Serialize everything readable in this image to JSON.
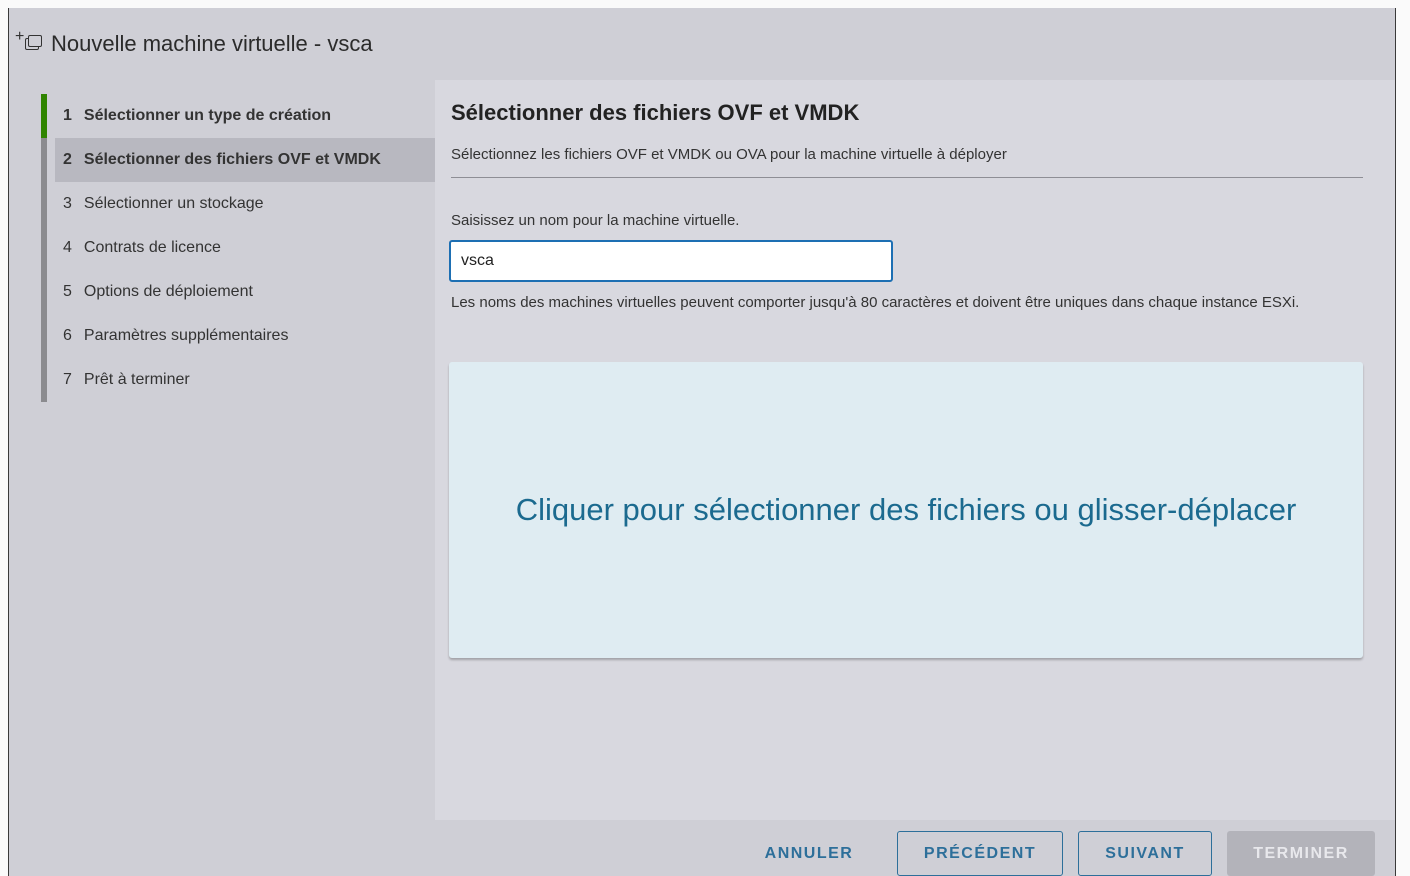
{
  "window": {
    "title": "Nouvelle machine virtuelle - vsca",
    "icon": "new-vm-icon"
  },
  "steps": [
    {
      "num": "1",
      "label": "Sélectionner un type de création",
      "state": "done"
    },
    {
      "num": "2",
      "label": "Sélectionner des fichiers OVF et VMDK",
      "state": "active"
    },
    {
      "num": "3",
      "label": "Sélectionner un stockage",
      "state": "pending"
    },
    {
      "num": "4",
      "label": "Contrats de licence",
      "state": "pending"
    },
    {
      "num": "5",
      "label": "Options de déploiement",
      "state": "pending"
    },
    {
      "num": "6",
      "label": "Paramètres supplémentaires",
      "state": "pending"
    },
    {
      "num": "7",
      "label": "Prêt à terminer",
      "state": "pending"
    }
  ],
  "main": {
    "title": "Sélectionner des fichiers OVF et VMDK",
    "subtitle": "Sélectionnez les fichiers OVF et VMDK ou OVA pour la machine virtuelle à déployer",
    "name_label": "Saisissez un nom pour la machine virtuelle.",
    "name_value": "vsca",
    "help_text": "Les noms des machines virtuelles peuvent comporter jusqu'à 80 caractères et doivent être uniques dans chaque instance ESXi.",
    "dropzone_text": "Cliquer pour sélectionner des fichiers ou glisser-déplacer"
  },
  "footer": {
    "cancel_label": "ANNULER",
    "prev_label": "PRÉCÉDENT",
    "next_label": "SUIVANT",
    "finish_label": "TERMINER"
  },
  "colors": {
    "accent": "#2d6f9a",
    "step_done": "#2f8400",
    "input_focus": "#1d6fb3",
    "dropzone_bg": "#dfecf2"
  }
}
